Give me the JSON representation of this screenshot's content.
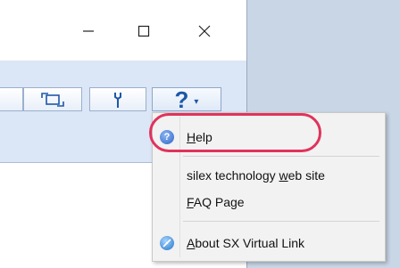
{
  "window": {
    "controls": {
      "minimize": "—",
      "maximize": "☐",
      "close": "✕"
    }
  },
  "toolbar": {
    "help_glyph": "?",
    "help_caret": "▾"
  },
  "help_menu": {
    "items": [
      {
        "label_parts": [
          "",
          "H",
          "elp"
        ],
        "icon": "help-circle-icon"
      },
      {
        "label_parts": [
          "silex technology ",
          "w",
          "eb site"
        ],
        "icon": ""
      },
      {
        "label_parts": [
          "",
          "F",
          "AQ Page"
        ],
        "icon": ""
      },
      {
        "label_parts": [
          "",
          "A",
          "bout SX Virtual Link"
        ],
        "icon": "about-globe-icon"
      }
    ]
  },
  "colors": {
    "highlight_ring": "#e0335b",
    "accent": "#1e57a7",
    "ribbon": "#dbe6f6"
  }
}
